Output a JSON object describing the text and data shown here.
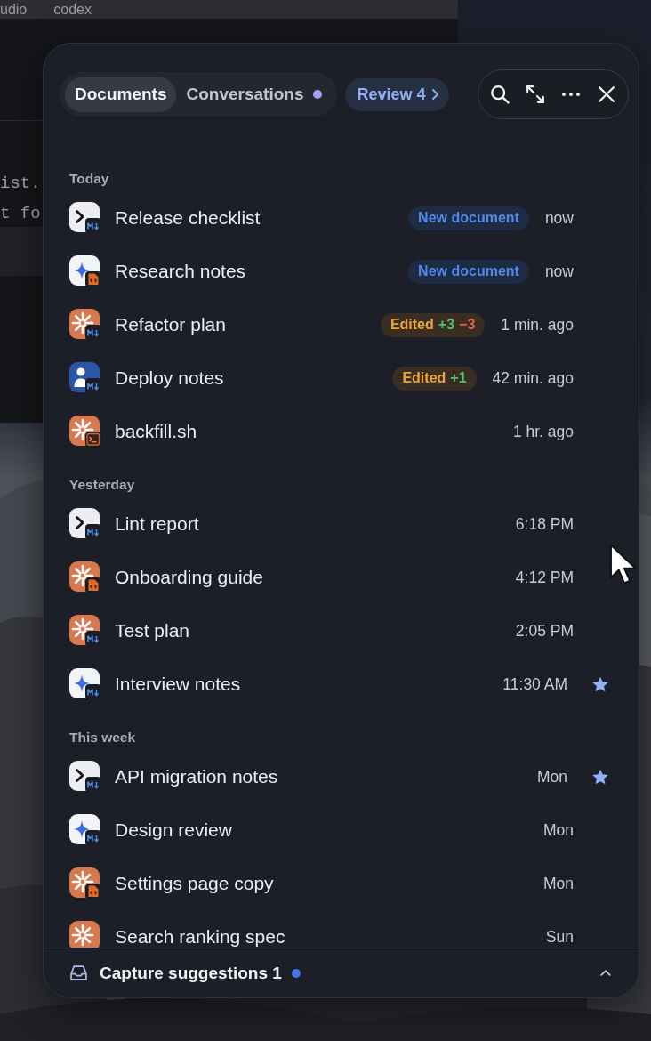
{
  "background": {
    "tabs": [
      "udio",
      "codex"
    ],
    "lines": [
      "ist.",
      "t fo"
    ]
  },
  "panel": {
    "tabs": [
      {
        "label": "Documents",
        "selected": true,
        "unread": false
      },
      {
        "label": "Conversations",
        "selected": false,
        "unread": true
      }
    ],
    "review": {
      "label": "Review 4"
    },
    "toolbar": [
      {
        "kind": "search"
      },
      {
        "kind": "expand"
      },
      {
        "kind": "more"
      },
      {
        "kind": "close"
      }
    ],
    "sections": [
      {
        "title": "Today",
        "items": [
          {
            "title": "Release checklist",
            "kind": "prompt-markdown",
            "tag": {
              "kind": "new",
              "label": "New document"
            },
            "time": "now",
            "starred": false
          },
          {
            "title": "Research notes",
            "kind": "sparkle-code",
            "tag": {
              "kind": "new",
              "label": "New document"
            },
            "time": "now",
            "starred": false
          },
          {
            "title": "Refactor plan",
            "kind": "burst-markdown",
            "tag": {
              "kind": "edited",
              "label": "Edited",
              "added": "+3",
              "removed": "−3"
            },
            "time": "1 min. ago",
            "starred": false
          },
          {
            "title": "Deploy notes",
            "kind": "person-markdown",
            "tag": {
              "kind": "edited",
              "label": "Edited",
              "added": "+1"
            },
            "time": "42 min. ago",
            "starred": false
          },
          {
            "title": "backfill.sh",
            "kind": "burst-script",
            "time": "1 hr. ago",
            "starred": false
          }
        ]
      },
      {
        "title": "Yesterday",
        "items": [
          {
            "title": "Lint report",
            "kind": "prompt-markdown",
            "time": "6:18 PM",
            "starred": false
          },
          {
            "title": "Onboarding guide",
            "kind": "burst-code",
            "time": "4:12 PM",
            "starred": false
          },
          {
            "title": "Test plan",
            "kind": "burst-markdown",
            "time": "2:05 PM",
            "starred": false
          },
          {
            "title": "Interview notes",
            "kind": "sparkle-markdown",
            "time": "11:30 AM",
            "starred": true
          }
        ]
      },
      {
        "title": "This week",
        "items": [
          {
            "title": "API migration notes",
            "kind": "prompt-markdown",
            "time": "Mon",
            "starred": true
          },
          {
            "title": "Design review",
            "kind": "sparkle-markdown",
            "time": "Mon",
            "starred": false
          },
          {
            "title": "Settings page copy",
            "kind": "burst-code",
            "time": "Mon",
            "starred": false
          },
          {
            "title": "Search ranking spec",
            "kind": "burst",
            "time": "Sun",
            "starred": false
          }
        ]
      }
    ],
    "footer": {
      "label": "Capture suggestions 1",
      "unread": true,
      "expanded": false
    }
  }
}
